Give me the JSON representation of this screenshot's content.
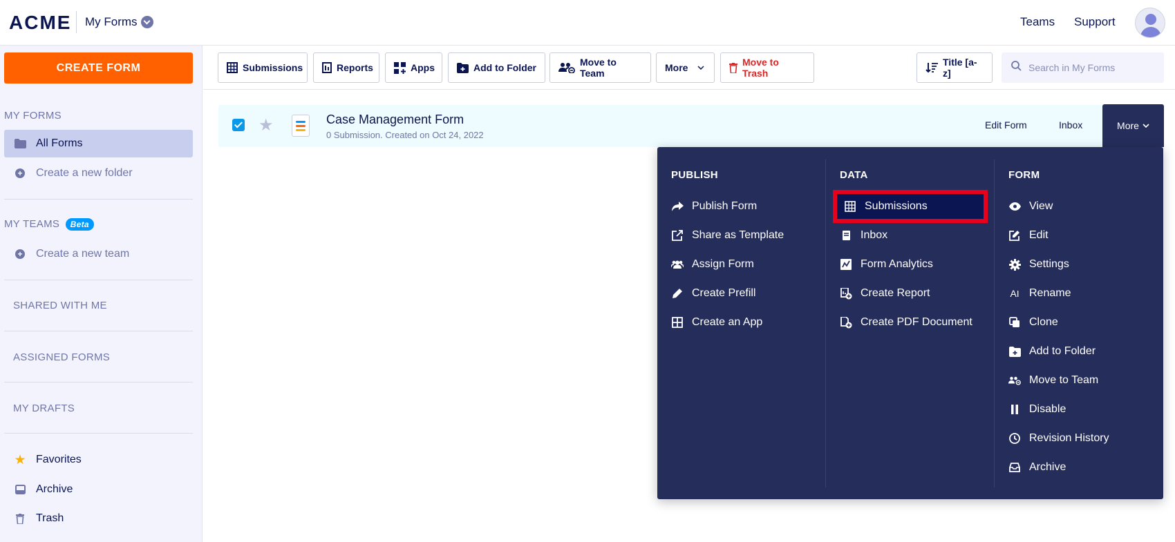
{
  "header": {
    "logo": "ACME",
    "title": "My Forms",
    "links": [
      "Teams",
      "Support"
    ]
  },
  "sidebar": {
    "create_label": "CREATE FORM",
    "my_forms_label": "MY FORMS",
    "all_forms": "All Forms",
    "create_folder": "Create a new folder",
    "my_teams_label": "MY TEAMS",
    "beta": "Beta",
    "create_team": "Create a new team",
    "shared": "SHARED WITH ME",
    "assigned": "ASSIGNED FORMS",
    "drafts": "MY DRAFTS",
    "favorites": "Favorites",
    "archive": "Archive",
    "trash": "Trash"
  },
  "toolbar": {
    "submissions": "Submissions",
    "reports": "Reports",
    "apps": "Apps",
    "add_folder": "Add to Folder",
    "move_team": "Move to Team",
    "more": "More",
    "trash": "Move to Trash",
    "sort": "Title [a-z]",
    "search_placeholder": "Search in My Forms"
  },
  "form": {
    "title": "Case Management Form",
    "subtitle": "0 Submission. Created on Oct 24, 2022",
    "edit": "Edit Form",
    "inbox": "Inbox",
    "more": "More"
  },
  "menu": {
    "publish": {
      "heading": "PUBLISH",
      "items": [
        "Publish Form",
        "Share as Template",
        "Assign Form",
        "Create Prefill",
        "Create an App"
      ]
    },
    "data": {
      "heading": "DATA",
      "items": [
        "Submissions",
        "Inbox",
        "Form Analytics",
        "Create Report",
        "Create PDF Document"
      ]
    },
    "form": {
      "heading": "FORM",
      "items": [
        "View",
        "Edit",
        "Settings",
        "Rename",
        "Clone",
        "Add to Folder",
        "Move to Team",
        "Disable",
        "Revision History",
        "Archive"
      ]
    }
  },
  "colors": {
    "accent": "#ff6100",
    "menu_bg": "#252d5b",
    "highlight_border": "#e8001c",
    "navy": "#0a1551"
  }
}
